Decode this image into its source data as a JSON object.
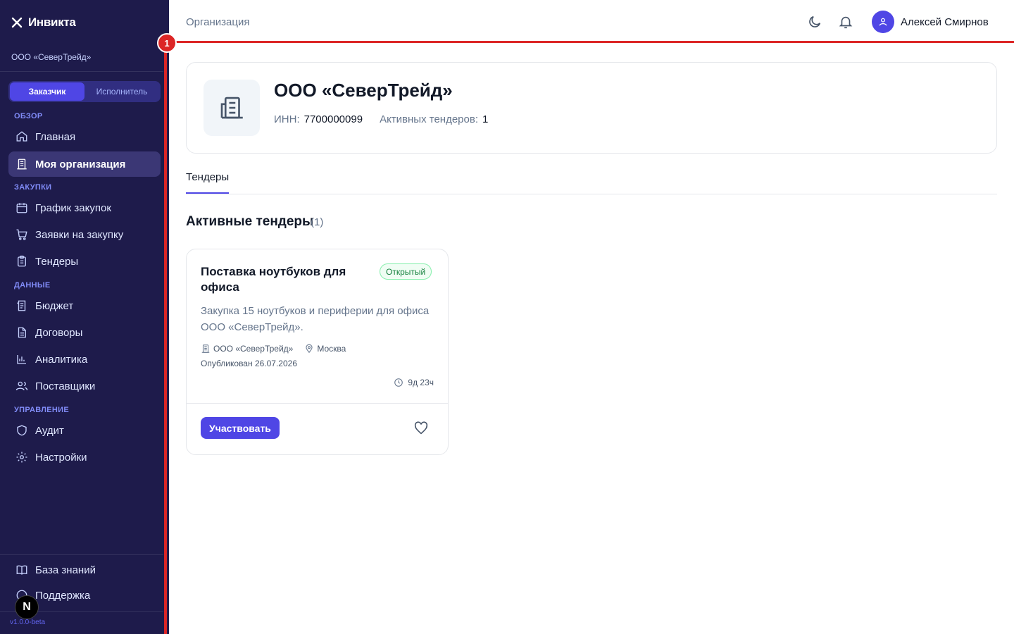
{
  "brand": {
    "name": "Инвикта"
  },
  "sidebar": {
    "org_name": "ООО «СеверТрейд»",
    "roles": [
      "Заказчик",
      "Исполнитель"
    ],
    "active_role": "Заказчик",
    "sections": {
      "overview": "ОБЗОР",
      "purchases": "ЗАКУПКИ",
      "data": "ДАННЫЕ",
      "management": "УПРАВЛЕНИЕ"
    },
    "items": {
      "home": "Главная",
      "my_org": "Моя организация",
      "schedule": "График закупок",
      "requests": "Заявки на закупку",
      "tenders": "Тендеры",
      "budget": "Бюджет",
      "contracts": "Договоры",
      "analytics": "Аналитика",
      "suppliers": "Поставщики",
      "audit": "Аудит",
      "settings": "Настройки",
      "knowledge": "База знаний",
      "support": "Поддержка"
    },
    "version": "v1.0.0-beta",
    "n_badge": "N"
  },
  "annotation": {
    "marker": "1"
  },
  "header": {
    "breadcrumb": "Организация",
    "user_name": "Алексей Смирнов"
  },
  "org": {
    "title": "ООО «СеверТрейд»",
    "inn_label": "ИНН:",
    "inn_value": "7700000099",
    "active_label": "Активных тендеров:",
    "active_value": "1"
  },
  "tabs": [
    "Тендеры"
  ],
  "section": {
    "title": "Активные тендеры",
    "count": "(1)"
  },
  "tender": {
    "title": "Поставка ноутбуков для офиса",
    "status": "Открытый",
    "description": "Закупка 15 ноутбуков и периферии для офиса ООО «СеверТрейд».",
    "organization": "ООО «СеверТрейд»",
    "location": "Москва",
    "published": "Опубликован 26.07.2026",
    "time_left": "9д 23ч",
    "action": "Участвовать"
  },
  "colors": {
    "sidebar_bg": "#1e1b4b",
    "accent": "#4f46e5",
    "highlight": "#dc2626",
    "status_open": "#15803d"
  }
}
